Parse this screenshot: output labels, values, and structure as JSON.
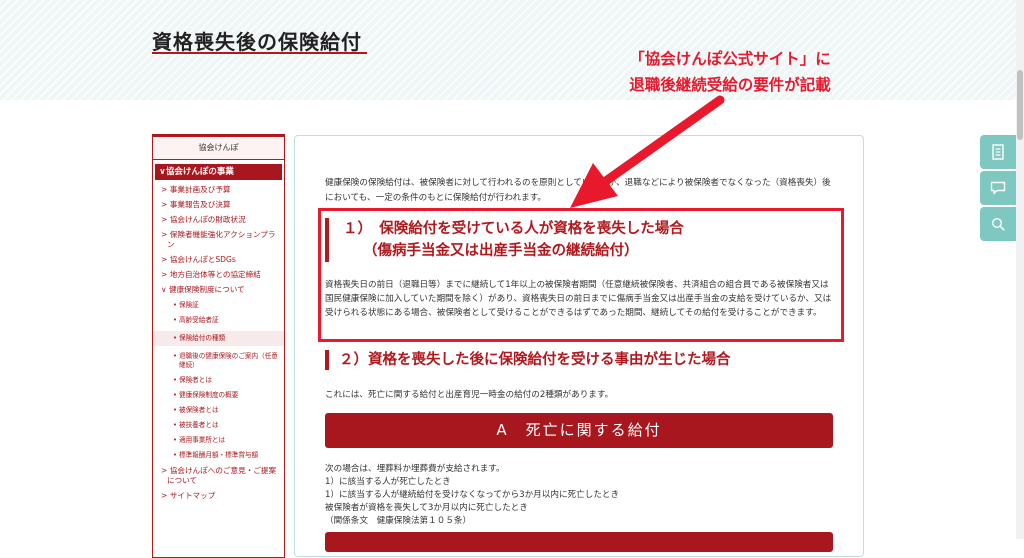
{
  "page": {
    "title": "資格喪失後の保険給付"
  },
  "annotation": {
    "line1": "「協会けんぽ公式サイト」に",
    "line2": "退職後継続受給の要件が記載"
  },
  "sidebar": {
    "header": "協会けんぽ",
    "category": "∨協会けんぽの事業",
    "items": [
      {
        "label": "> 事業計画及び予算"
      },
      {
        "label": "> 事業報告及び決算"
      },
      {
        "label": "> 協会けんぽの財政状況"
      },
      {
        "label": "> 保険者機能強化アクションプラン"
      },
      {
        "label": "> 協会けんぽとSDGs"
      },
      {
        "label": "> 地方自治体等との協定締結"
      },
      {
        "label": "∨ 健康保険制度について"
      }
    ],
    "subitems": [
      {
        "label": "• 保険証"
      },
      {
        "label": "• 高齢受給者証"
      },
      {
        "label": "• 保険給付の種類"
      },
      {
        "label": "• 退職後の健康保険のご案内（任意継続）"
      },
      {
        "label": "• 保険者とは"
      },
      {
        "label": "• 健康保険制度の概要"
      },
      {
        "label": "• 被保険者とは"
      },
      {
        "label": "• 被扶養者とは"
      },
      {
        "label": "• 適用事業所とは"
      },
      {
        "label": "• 標準報酬月額・標準賞与額"
      }
    ],
    "items_bottom": [
      {
        "label": "> 協会けんぽへのご意見・ご提案について"
      },
      {
        "label": "> サイトマップ"
      }
    ]
  },
  "content": {
    "intro": "健康保険の保険給付は、被保険者に対して行われるのを原則としていますが、退職などにより被保険者でなくなった（資格喪失）後においても、一定の条件のもとに保険給付が行われます。",
    "heading1_line1": "１）　保険給付を受けている人が資格を喪失した場合",
    "heading1_line2": "（傷病手当金又は出産手当金の継続給付）",
    "para1": "資格喪失日の前日（退職日等）までに継続して1年以上の被保険者期間（任意継続被保険者、共済組合の組合員である被保険者又は国民健康保険に加入していた期間を除く）があり、資格喪失日の前日までに傷病手当金又は出産手当金の支給を受けているか、又は受けられる状態にある場合、被保険者として受けることができるはずであった期間、継続してその給付を受けることができます。",
    "heading2": "２）資格を喪失した後に保険給付を受ける事由が生じた場合",
    "para2": "これには、死亡に関する給付と出産育児一時金の給付の2種類があります。",
    "button_a": "A　死亡に関する給付",
    "list_intro": "次の場合は、埋葬料か埋葬費が支給されます。",
    "list": [
      "1）に該当する人が死亡したとき",
      "1）に該当する人が継続給付を受けなくなってから3か月以内に死亡したとき",
      "被保険者が資格を喪失して3か月以内に死亡したとき",
      "（関係条文　健康保険法第１０５条）"
    ]
  },
  "float_buttons": [
    {
      "icon": "document-icon"
    },
    {
      "icon": "chat-icon"
    },
    {
      "icon": "search-icon"
    }
  ],
  "colors": {
    "brand": "#a8171d",
    "annotation": "#e8192c",
    "accent": "#7fc8c2"
  }
}
